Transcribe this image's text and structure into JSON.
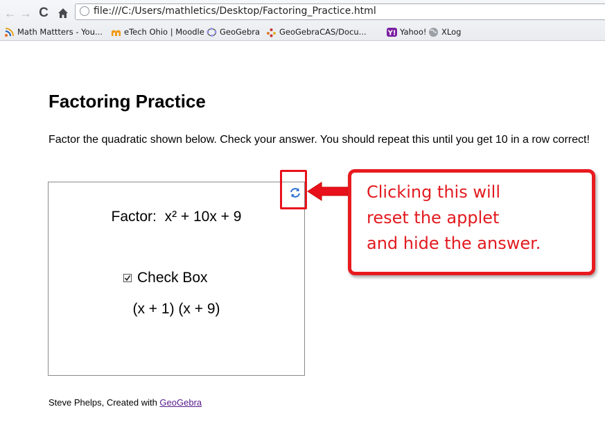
{
  "browser": {
    "url": "file:///C:/Users/mathletics/Desktop/Factoring_Practice.html",
    "bookmarks": [
      {
        "label": "Math Mattters - You...",
        "icon": "rss-icon"
      },
      {
        "label": "eTech Ohio | Moodle",
        "icon": "moodle-icon"
      },
      {
        "label": "GeoGebra",
        "icon": "geogebra-icon"
      },
      {
        "label": "GeoGebraCAS/Docu...",
        "icon": "cas-icon"
      },
      {
        "label": "Yahoo!",
        "icon": "yahoo-icon"
      },
      {
        "label": "XLog",
        "icon": "globe-icon"
      }
    ]
  },
  "page": {
    "title": "Factoring Practice",
    "instructions": "Factor the quadratic shown below. Check your answer. You should repeat this until you get 10 in a row correct!"
  },
  "applet": {
    "factor_prefix": "Factor:",
    "expression": "x² + 10x + 9",
    "checkbox_label": "Check Box",
    "checkbox_checked": true,
    "answer": "(x + 1) (x + 9)"
  },
  "callout": {
    "line1": "Clicking this will",
    "line2": "reset the applet",
    "line3": "and hide the answer.",
    "color": "#e21a1f"
  },
  "footer": {
    "text": "Steve Phelps, Created with ",
    "link": "GeoGebra"
  }
}
